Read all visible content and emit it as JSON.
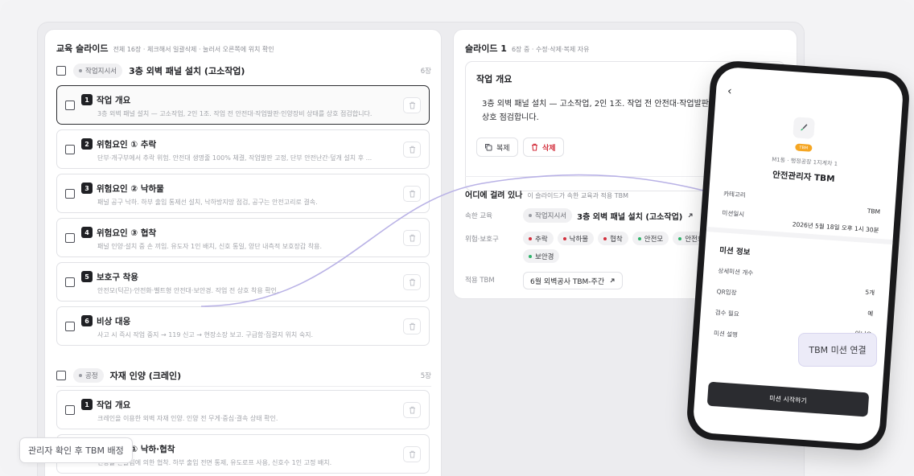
{
  "left": {
    "title": "교육 슬라이드",
    "subtitle": "전체 16장 · 체크해서 일괄삭제 · 눌러서 오른쪽에 위치 확인",
    "groups": [
      {
        "tag": "작업지시서",
        "title": "3층 외벽 패널 설치 (고소작업)",
        "count": "6장",
        "slides": [
          {
            "num": "1",
            "title": "작업 개요",
            "desc": "3층 외벽 패널 설치 — 고소작업, 2인 1조. 작업 전 안전대·작업발판·인양장비 상태를 상호 점검합니다."
          },
          {
            "num": "2",
            "title": "위험요인 ① 추락",
            "desc": "단부·개구부에서 추락 위험. 안전대 생명줄 100% 체결, 작업발판 고정, 단부 안전난간·덮개 설치 후 ..."
          },
          {
            "num": "3",
            "title": "위험요인 ② 낙하물",
            "desc": "패널 공구 낙하. 하부 출입 통제선 설치, 낙하방지망 점검, 공구는 안전고리로 결속."
          },
          {
            "num": "4",
            "title": "위험요인 ③ 협착",
            "desc": "패널 인양·설치 중 손 끼임. 유도자 1인 배치, 신호 통일, 양단 내측적 보호장갑 착용."
          },
          {
            "num": "5",
            "title": "보호구 착용",
            "desc": "안전모(턱끈)·안전화·벨트형 안전대·보안경. 작업 전 상호 착용 확인."
          },
          {
            "num": "6",
            "title": "비상 대응",
            "desc": "사고 시 즉시 작업 중지 → 119 신고 → 현장소장 보고. 구급함·집결지 위치 숙지."
          }
        ]
      },
      {
        "tag": "공정",
        "title": "자재 인양 (크레인)",
        "count": "5장",
        "slides": [
          {
            "num": "1",
            "title": "작업 개요",
            "desc": "크레인을 이용한 외벽 자재 인양. 인양 전 무게·중심·결속 상태 확인."
          },
          {
            "num": "2",
            "title": "위험요인 ① 낙하·협착",
            "desc": "인양물 흔들림에 의한 협착. 하부 출입 전면 통제, 유도로프 사용, 신호수 1인 고정 배치."
          }
        ]
      }
    ],
    "bottom_chip": "관리자 확인 후 TBM 배정"
  },
  "right": {
    "title": "슬라이드 1",
    "subtitle": "6장 중 · 수정·삭제·복제 자유",
    "overview_title": "작업 개요",
    "overview_body": "3층 외벽 패널 설치 — 고소작업, 2인 1조. 작업 전 안전대·작업발판·인양장비 상태를 상호 점검합니다.",
    "copy_label": "복제",
    "delete_label": "삭제",
    "where_title": "어디에 걸려 있나",
    "where_sub": "이 슬라이드가 속한 교육과 적용 TBM",
    "belong_label": "속한 교육",
    "belong_tag": "작업지시서",
    "belong_title": "3층 외벽 패널 설치 (고소작업)",
    "risk_label": "위험·보호구",
    "risks": [
      {
        "label": "추락",
        "color": "#d32f3c"
      },
      {
        "label": "낙하물",
        "color": "#d32f3c"
      },
      {
        "label": "협착",
        "color": "#d32f3c"
      },
      {
        "label": "안전모",
        "color": "#2fb36b"
      },
      {
        "label": "안전화",
        "color": "#2fb36b"
      },
      {
        "label": "보안경",
        "color": "#2fb36b"
      }
    ],
    "tbm_label": "적용 TBM",
    "tbm_value": "6월 외벽공사 TBM-주간"
  },
  "phone": {
    "pill": "TBM",
    "sub": "M1동 · 행정공장 1지계차 1",
    "title": "안전관리자 TBM",
    "rows": [
      {
        "k": "카테고리",
        "v": "TBM"
      },
      {
        "k": "미션일시",
        "v": "2026년 5월 18일 오후 1시 30분"
      }
    ],
    "section": "미션 정보",
    "info": [
      {
        "k": "상세미션 개수",
        "v": "5개"
      },
      {
        "k": "QR입장",
        "v": "예"
      },
      {
        "k": "검수 필요",
        "v": "아니오"
      },
      {
        "k": "미션 설명",
        "v": ""
      }
    ],
    "cta": "미션 시작하기"
  },
  "tbm_connect": "TBM 미션 연결",
  "colors": {
    "accent_curve": "#b9b2e6",
    "danger": "#d32f3c",
    "safe": "#2fb36b"
  }
}
